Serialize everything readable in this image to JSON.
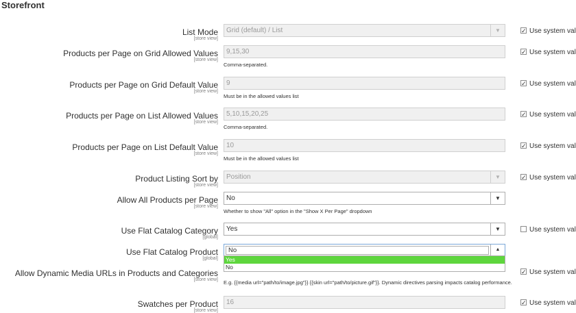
{
  "section": {
    "title": "Storefront"
  },
  "system_value_label": "Use system value",
  "rows": [
    {
      "label": "List Mode",
      "scope": "[store view]",
      "value": "Grid (default) / List",
      "type": "select",
      "enabled": false,
      "note": "",
      "system": true
    },
    {
      "label": "Products per Page on Grid Allowed Values",
      "scope": "[store view]",
      "value": "9,15,30",
      "type": "text",
      "enabled": false,
      "note": "Comma-separated.",
      "system": true
    },
    {
      "label": "Products per Page on Grid Default Value",
      "scope": "[store view]",
      "value": "9",
      "type": "text",
      "enabled": false,
      "note": "Must be in the allowed values list",
      "system": true
    },
    {
      "label": "Products per Page on List Allowed Values",
      "scope": "[store view]",
      "value": "5,10,15,20,25",
      "type": "text",
      "enabled": false,
      "note": "Comma-separated.",
      "system": true
    },
    {
      "label": "Products per Page on List Default Value",
      "scope": "[store view]",
      "value": "10",
      "type": "text",
      "enabled": false,
      "note": "Must be in the allowed values list",
      "system": true
    },
    {
      "label": "Product Listing Sort by",
      "scope": "[store view]",
      "value": "Position",
      "type": "select",
      "enabled": false,
      "note": "",
      "system": true
    },
    {
      "label": "Allow All Products per Page",
      "scope": "[store view]",
      "value": "No",
      "type": "select",
      "enabled": true,
      "note": "Whether to show \"All\" option in the \"Show X Per Page\" dropdown",
      "system": null
    },
    {
      "label": "Use Flat Catalog Category",
      "scope": "[global]",
      "value": "Yes",
      "type": "select",
      "enabled": true,
      "note": "",
      "system": false
    },
    {
      "label": "Use Flat Catalog Product",
      "scope": "[global]",
      "value": "No",
      "type": "select-open",
      "enabled": true,
      "note": "",
      "system": null
    },
    {
      "label": "Allow Dynamic Media URLs in Products and Categories",
      "scope": "[store view]",
      "value": "",
      "type": "hidden",
      "enabled": false,
      "note": "E.g. {{media url=\"path/to/image.jpg\"}} {{skin url=\"path/to/picture.gif\"}}. Dynamic directives parsing impacts catalog performance.",
      "system": true
    },
    {
      "label": "Swatches per Product",
      "scope": "[store view]",
      "value": "16",
      "type": "text",
      "enabled": false,
      "note": "",
      "system": true
    }
  ],
  "flat_product_dropdown": {
    "options": [
      "Yes",
      "No"
    ],
    "highlighted": "Yes"
  }
}
